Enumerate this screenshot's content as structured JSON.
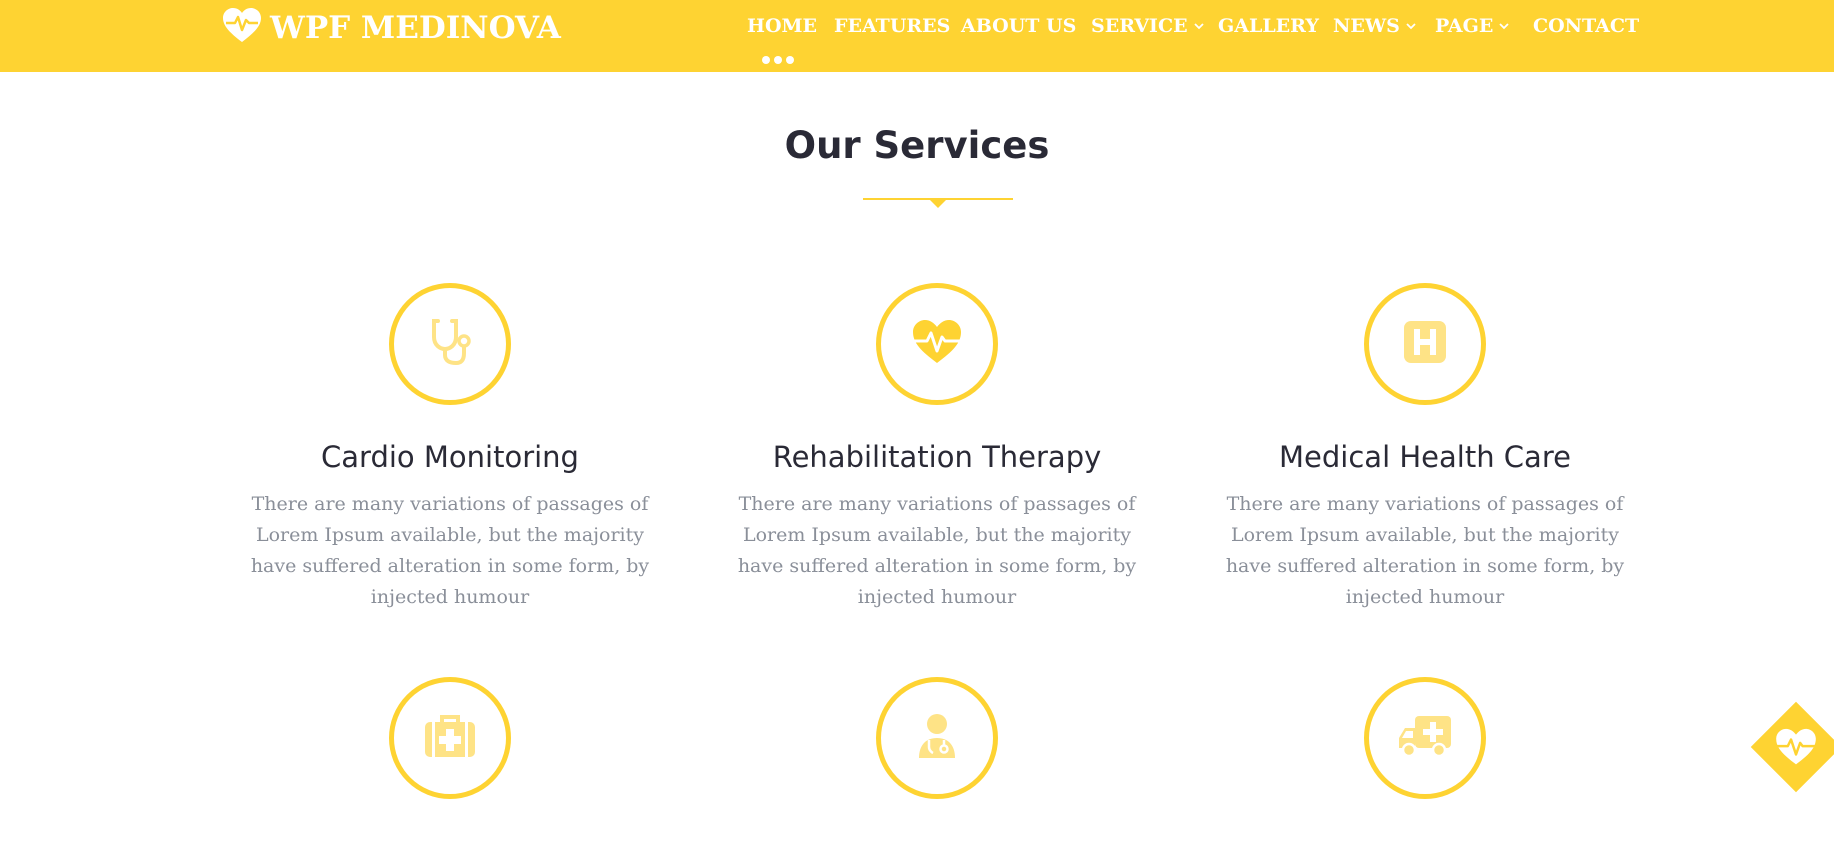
{
  "brand": {
    "name": "WPF MEDINOVA",
    "logo_icon": "heart-pulse-icon"
  },
  "nav": {
    "items": [
      {
        "label": "HOME",
        "has_dropdown": false,
        "active": true
      },
      {
        "label": "FEATURES",
        "has_dropdown": false
      },
      {
        "label": "ABOUT US",
        "has_dropdown": false
      },
      {
        "label": "SERVICE",
        "has_dropdown": true
      },
      {
        "label": "GALLERY",
        "has_dropdown": false
      },
      {
        "label": "NEWS",
        "has_dropdown": true
      },
      {
        "label": "PAGE",
        "has_dropdown": true
      },
      {
        "label": "CONTACT",
        "has_dropdown": false
      }
    ]
  },
  "section": {
    "title": "Our Services"
  },
  "services": [
    {
      "icon": "stethoscope-icon",
      "title": "Cardio Monitoring",
      "description": "There are many variations of passages of Lorem Ipsum available, but the majority have suffered alteration in some form, by injected humour"
    },
    {
      "icon": "heart-pulse-icon",
      "title": "Rehabilitation Therapy",
      "description": "There are many variations of passages of Lorem Ipsum available, but the majority have suffered alteration in some form, by injected humour"
    },
    {
      "icon": "hospital-h-icon",
      "title": "Medical Health Care",
      "description": "There are many variations of passages of Lorem Ipsum available, but the majority have suffered alteration in some form, by injected humour"
    },
    {
      "icon": "medical-kit-icon"
    },
    {
      "icon": "doctor-icon"
    },
    {
      "icon": "ambulance-icon"
    }
  ],
  "colors": {
    "accent": "#fed332",
    "heading": "#2a2a36",
    "body_text": "#8a8f99",
    "nav_text": "#ffffff"
  },
  "floating_button": {
    "icon": "heart-pulse-icon"
  }
}
